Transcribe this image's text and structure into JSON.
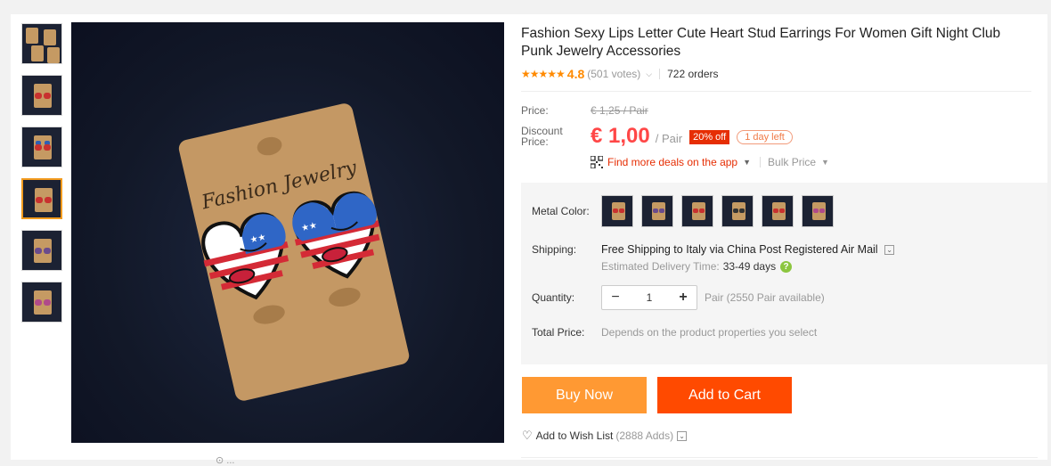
{
  "thumbnails": [
    {
      "name": "thumb-1",
      "active": false
    },
    {
      "name": "thumb-2",
      "active": false
    },
    {
      "name": "thumb-3",
      "active": false
    },
    {
      "name": "thumb-4",
      "active": true
    },
    {
      "name": "thumb-5",
      "active": false
    },
    {
      "name": "thumb-6",
      "active": false
    }
  ],
  "main_image": {
    "card_text": "Fashion Jewelry",
    "caption": "⊙ ..."
  },
  "product": {
    "title": "Fashion Sexy Lips Letter Cute Heart Stud Earrings For Women Gift Night Club Punk Jewelry Accessories",
    "stars": "★★★★★",
    "rating": "4.8",
    "votes": "(501 votes)",
    "orders": "722 orders"
  },
  "price": {
    "price_label": "Price:",
    "original": "€ 1,25 / Pair",
    "discount_label": "Discount Price:",
    "current": "€ 1,00",
    "unit": "/ Pair",
    "off_badge": "20% off",
    "time_left": "1 day left",
    "deals_link": "Find more deals on the app",
    "bulk_price": "Bulk Price"
  },
  "options": {
    "metal_color_label": "Metal Color:",
    "swatch_count": 6,
    "shipping_label": "Shipping:",
    "shipping_free": "Free Shipping to",
    "shipping_dest": "Italy via China Post Registered Air Mail",
    "est_label": "Estimated Delivery Time:",
    "est_days": "33-49 days",
    "quantity_label": "Quantity:",
    "quantity_minus": "−",
    "quantity_value": "1",
    "quantity_plus": "+",
    "quantity_available": "Pair (2550 Pair available)",
    "total_label": "Total Price:",
    "total_text": "Depends on the product properties you select"
  },
  "actions": {
    "buy_now": "Buy Now",
    "add_to_cart": "Add to Cart",
    "wishlist": "Add to Wish List",
    "wishlist_count": "(2888 Adds)"
  },
  "colors": {
    "accent_orange": "#ff9933",
    "cart_orange": "#ff4a00",
    "price_red": "#ff4747",
    "star": "#ff8a00"
  }
}
